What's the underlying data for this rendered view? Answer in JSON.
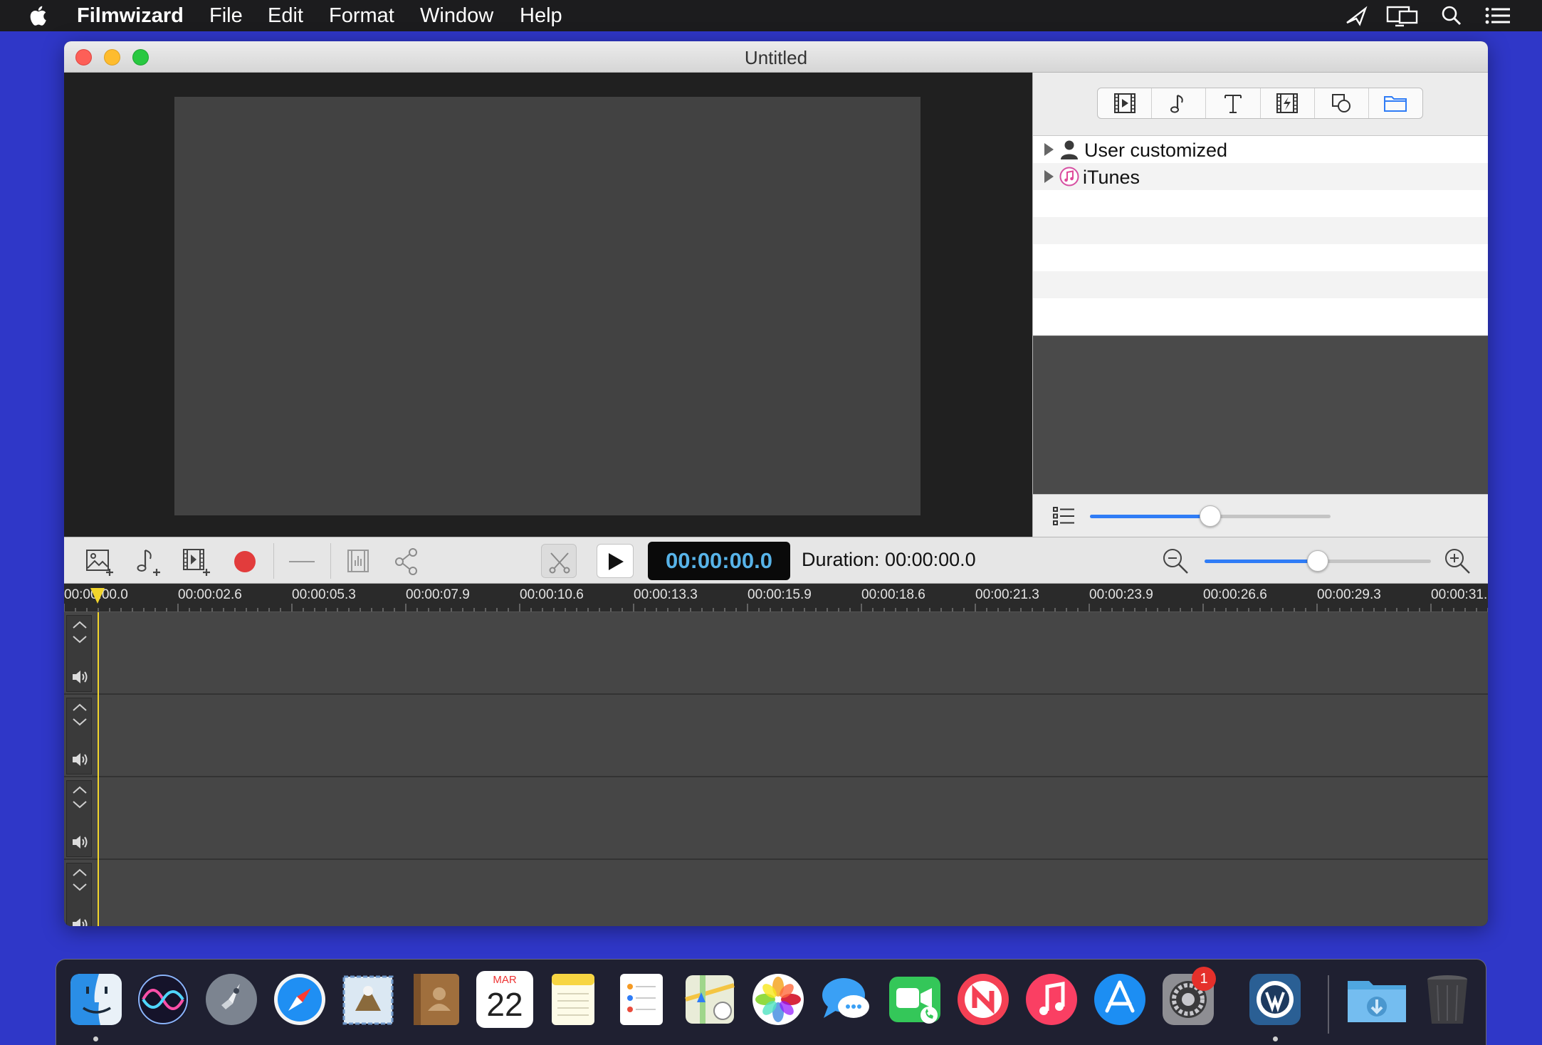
{
  "menubar": {
    "app_name": "Filmwizard",
    "items": [
      "File",
      "Edit",
      "Format",
      "Window",
      "Help"
    ]
  },
  "window": {
    "title": "Untitled"
  },
  "library": {
    "tabs": [
      "video-library-icon",
      "music-icon",
      "text-icon",
      "transition-icon",
      "shapes-icon",
      "folder-icon"
    ],
    "selected_tab": 5,
    "items": [
      {
        "label": "User customized",
        "icon": "user-icon"
      },
      {
        "label": "iTunes",
        "icon": "itunes-icon"
      }
    ],
    "size_slider": 0.5
  },
  "timeline": {
    "timecode": "00:00:00.0",
    "duration": "Duration: 00:00:00.0",
    "zoom_slider": 0.5,
    "ruler_labels": [
      "00:00:00.0",
      "00:00:02.6",
      "00:00:05.3",
      "00:00:07.9",
      "00:00:10.6",
      "00:00:13.3",
      "00:00:15.9",
      "00:00:18.6",
      "00:00:21.3",
      "00:00:23.9",
      "00:00:26.6",
      "00:00:29.3",
      "00:00:31."
    ],
    "track_count": 4
  },
  "dock": {
    "apps": [
      "finder",
      "siri",
      "launchpad",
      "safari",
      "mail",
      "contacts",
      "calendar",
      "notes",
      "reminders",
      "maps",
      "photos",
      "messages",
      "facetime",
      "news",
      "music",
      "app-store",
      "system-preferences",
      "filmwizard",
      "downloads",
      "trash"
    ],
    "calendar_month": "MAR",
    "calendar_day": "22",
    "badge": "1"
  }
}
